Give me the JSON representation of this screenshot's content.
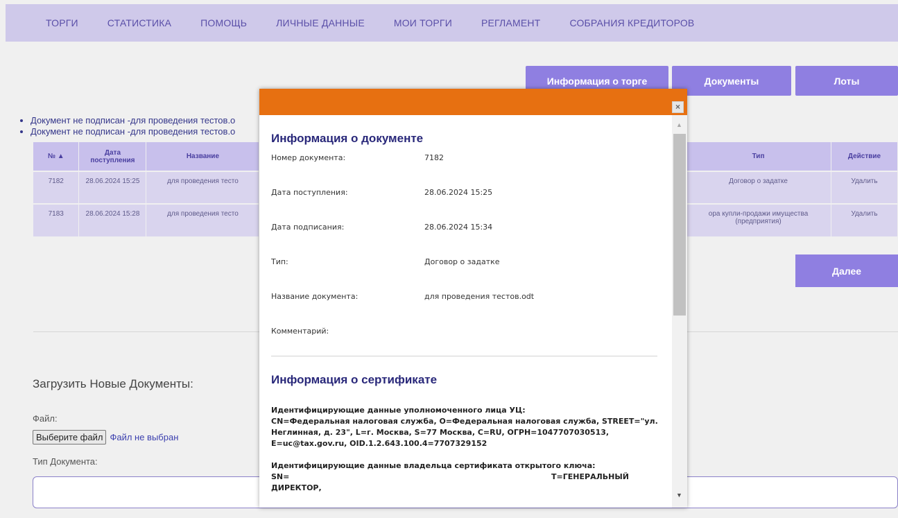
{
  "nav": {
    "items": [
      {
        "label": "ТОРГИ"
      },
      {
        "label": "СТАТИСТИКА"
      },
      {
        "label": "ПОМОЩЬ"
      },
      {
        "label": "ЛИЧНЫЕ ДАННЫЕ"
      },
      {
        "label": "МОИ ТОРГИ"
      },
      {
        "label": "РЕГЛАМЕНТ"
      },
      {
        "label": "СОБРАНИЯ КРЕДИТОРОВ"
      }
    ]
  },
  "tabs": {
    "info": "Информация о торге",
    "docs": "Документы",
    "lots": "Лоты"
  },
  "notes": [
    "Документ не подписан -для проведения тестов.о",
    "Документ не подписан -для проведения тестов.о"
  ],
  "table": {
    "headers": {
      "num": "№ ▲",
      "date": "Дата поступления",
      "name": "Название",
      "type": "Тип",
      "action": "Действие"
    },
    "rows": [
      {
        "num": "7182",
        "date": "28.06.2024 15:25",
        "name": "для проведения тесто",
        "type": "Договор о задатке",
        "action": "Удалить"
      },
      {
        "num": "7183",
        "date": "28.06.2024 15:28",
        "name": "для проведения тесто",
        "type": "ора купли-продажи имущества (предприятия)",
        "action": "Удалить"
      }
    ]
  },
  "next_label": "Далее",
  "upload": {
    "title": "Загрузить Новые Документы:",
    "file_label": "Файл:",
    "file_button": "Выберите файл",
    "file_status": "Файл не выбран",
    "type_label": "Тип Документа:"
  },
  "modal": {
    "close": "×",
    "doc_title": "Информация о документе",
    "fields": [
      {
        "key": "Номер документа:",
        "value": "7182"
      },
      {
        "key": "Дата поступления:",
        "value": "28.06.2024 15:25"
      },
      {
        "key": "Дата подписания:",
        "value": "28.06.2024 15:34"
      },
      {
        "key": "Тип:",
        "value": "Договор о задатке"
      },
      {
        "key": "Название документа:",
        "value": "для проведения тестов.odt"
      },
      {
        "key": "Комментарий:",
        "value": ""
      }
    ],
    "cert_title": "Информация о сертификате",
    "cert_issuer_label": "Идентифицирующие данные уполномоченного лица УЦ:",
    "cert_issuer_data": "CN=Федеральная налоговая служба, O=Федеральная налоговая служба, STREET=\"ул. Неглинная, д. 23\", L=г. Москва, S=77 Москва, C=RU, ОГРН=1047707030513, E=uc@tax.gov.ru, OID.1.2.643.100.4=7707329152",
    "cert_owner_label": "Идентифицирующие данные владельца сертификата открытого ключа:",
    "cert_owner_data_start": "SN=",
    "cert_owner_data_end": "Т=ГЕНЕРАЛЬНЫЙ ДИРЕКТОР,"
  },
  "colors": {
    "accent": "#8f7fe1",
    "modal_header": "#e77011",
    "nav_bg": "#cfc9ea"
  }
}
